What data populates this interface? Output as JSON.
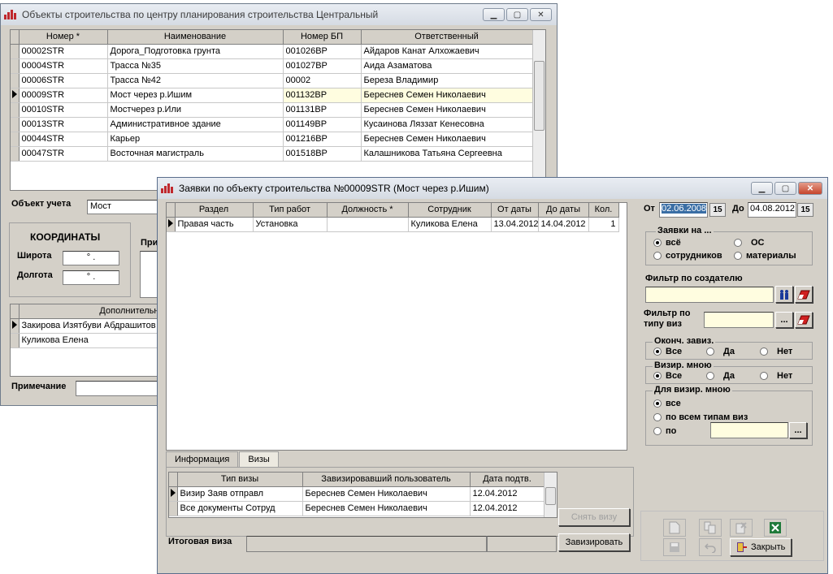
{
  "main_window": {
    "title": "Объекты строительства по центру планирования строительства Центральный",
    "columns": [
      "Номер *",
      "Наименование",
      "Номер БП",
      "Ответственный"
    ],
    "rows": [
      [
        "00002STR",
        "Дорога_Подготовка грунта",
        "001026BP",
        "Айдаров Канат Алхожаевич"
      ],
      [
        "00004STR",
        "Трасса №35",
        "001027BP",
        "Аида Азаматова"
      ],
      [
        "00006STR",
        "Трасса №42",
        "00002",
        "Береза Владимир"
      ],
      [
        "00009STR",
        "Мост через р.Ишим",
        "001132BP",
        "Береснев Семен Николаевич"
      ],
      [
        "00010STR",
        "Мостчерез р.Или",
        "001131BP",
        "Береснев Семен Николаевич"
      ],
      [
        "00013STR",
        "Административное здание",
        "001149BP",
        "Кусаинова Ляззат Кенесовна"
      ],
      [
        "00044STR",
        "Карьер",
        "001216BP",
        "Береснев Семен Николаевич"
      ],
      [
        "00047STR",
        "Восточная магистраль",
        "001518BP",
        "Калашникова  Татьяна Сергеевна"
      ]
    ],
    "object_label": "Объект учета",
    "object_value": "Мост",
    "coords_title": "КООРДИНАТЫ",
    "lat_label": "Широта",
    "lat_value": "° .",
    "lon_label": "Долгота",
    "lon_value": "° .",
    "pri_label": "При",
    "extra_header": "Дополнительные",
    "extra_rows": [
      "Закирова Изятбуви Абдрашитов",
      "Куликова Елена"
    ],
    "note_label": "Примечание"
  },
  "dialog": {
    "title": "Заявки по объекту строительства №00009STR (Мост через р.Ишим)",
    "columns": [
      "Раздел",
      "Тип работ",
      "Должность *",
      "Сотрудник",
      "От даты",
      "До даты",
      "Кол."
    ],
    "rows": [
      [
        "Правая часть",
        "Установка",
        "",
        "Куликова Елена",
        "13.04.2012",
        "14.04.2012",
        "1"
      ]
    ],
    "tabs": [
      "Информация",
      "Визы"
    ],
    "visa_columns": [
      "Тип визы",
      "Завизировавший пользователь",
      "Дата подтв."
    ],
    "visa_rows": [
      [
        "Визир Заяв отправл",
        "Береснев Семен Николаевич",
        "12.04.2012"
      ],
      [
        "Все документы Сотруд",
        "Береснев Семен Николаевич",
        "12.04.2012"
      ]
    ],
    "cancel_visa": "Снять визу",
    "do_visa": "Завизировать",
    "final_visa_label": "Итоговая виза",
    "filters": {
      "from_label": "От",
      "from_value": "02.06.2008",
      "to_label": "До",
      "to_value": "04.08.2012",
      "cal_btn": "15",
      "requests_caption": "Заявки на ...",
      "opt_all": "всё",
      "opt_os": "ОС",
      "opt_staff": "сотрудников",
      "opt_materials": "материалы",
      "creator_label": "Фильтр по создателю",
      "visa_type_label_1": "Фильтр по",
      "visa_type_label_2": "типу виз",
      "ellipsis": "...",
      "final_caption": "Оконч. завиз.",
      "visa_me_caption": "Визир. мною",
      "opt_all2": "Все",
      "opt_yes": "Да",
      "opt_no": "Нет",
      "for_me_caption": "Для визир. мною",
      "opt_all3": "все",
      "opt_by_all": "по всем типам виз",
      "opt_by": "по"
    },
    "close_btn": "Закрыть"
  }
}
